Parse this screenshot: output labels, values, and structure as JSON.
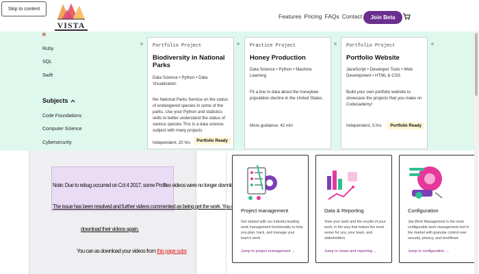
{
  "header": {
    "skip_link": "Skip to content",
    "logo_text": "VISTA",
    "nav": [
      "Features",
      "Pricing",
      "FAQs",
      "Contact"
    ],
    "join_label": "Join Beta",
    "cart_icon": "cart-icon"
  },
  "sidebar": {
    "items": [
      "R",
      "Ruby",
      "SQL",
      "Swift"
    ],
    "subjects_label": "Subjects",
    "subjects_icon": "chevron-up-icon",
    "subjects": [
      "Code Foundations",
      "Computer Science",
      "Cybersecurity"
    ]
  },
  "projects": [
    {
      "kind": "Portfolio Project",
      "title": "Biodiversity in National Parks",
      "tags": "Data Science • Python • Data Visualization",
      "desc": "the National Parks Service on the status of endangered species in some of the parks. Use your Python and statistics skills to better understand the status of various species This is a data science subject with many projects",
      "meta": "Independent, 20 hrs",
      "badge": "Portfolio Ready"
    },
    {
      "kind": "Practice Project",
      "title": "Honey Production",
      "tags": "Data Science • Python • Machine Learning",
      "desc": "Fit a line to data about the honeybee population decline in the United States.",
      "meta": "More guidance, 42 min",
      "badge": ""
    },
    {
      "kind": "Portfolio Project",
      "title": "Portfolio Website",
      "tags": "JavaScript • Developer Tools • Web Development • HTML & CSS",
      "desc": "Build your own portfolio website to showcase the projects that you make on Codecademy!",
      "meta": "Independent, 5 hrs",
      "badge": "Portfolio Ready"
    }
  ],
  "notice": {
    "line1": "Note: Due to rebug occurred on Cct 4 2017, some Profiles videos were no longer downloaded.",
    "line2": "The issue has been resolved and further videos commented as being get the work. You can now",
    "line3": "download their videos again.",
    "line4_prefix": "You can as download your videos from ",
    "line4_link": "this page subs"
  },
  "features": [
    {
      "icon": "project-management-illustration",
      "title": "Project management",
      "desc": "Get started with our industry-leading work management functionality to help you plan, track, and manage your team's work.",
      "link": "Jump to project management →"
    },
    {
      "icon": "data-reporting-illustration",
      "title": "Data & Reporting",
      "desc": "View your work and the results of your work, in the way that makes the most sense for you, your team, and stakeholders.",
      "link": "Jump to views and reporting →"
    },
    {
      "icon": "configuration-illustration",
      "title": "Configuration",
      "desc": "Jira Work Management is the most configurable work management tool in the market with granular control over security, privacy, and workflows.",
      "link": "Jump to configuration →"
    }
  ]
}
